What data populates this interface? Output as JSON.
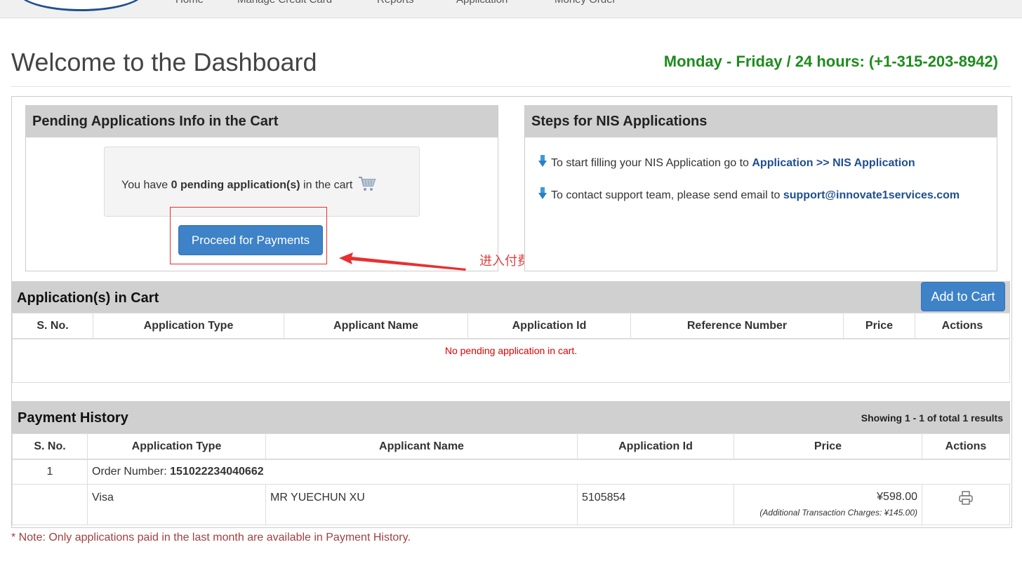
{
  "nav": {
    "items": [
      "Home",
      "Manage Credit Card",
      "Reports",
      "Application",
      "Money Order"
    ]
  },
  "header": {
    "title": "Welcome to the Dashboard",
    "hours": "Monday - Friday / 24 hours: (+1-315-203-8942)"
  },
  "pending_panel": {
    "title": "Pending Applications Info in the Cart",
    "text_prefix": "You have ",
    "count_text": "0 pending application(s)",
    "text_suffix": " in the cart",
    "proceed_label": "Proceed for Payments",
    "annotation": "进入付费"
  },
  "steps_panel": {
    "title": "Steps for NIS Applications",
    "step1_prefix": "To start filling your NIS Application go to ",
    "step1_link": "Application >> NIS Application",
    "step2_prefix": "To contact support team, please send email to ",
    "step2_link": "support@innovate1services.com"
  },
  "cart": {
    "title": "Application(s) in Cart",
    "add_label": "Add to Cart",
    "columns": [
      "S. No.",
      "Application Type",
      "Applicant Name",
      "Application Id",
      "Reference Number",
      "Price",
      "Actions"
    ],
    "empty_message": "No pending application in cart."
  },
  "history": {
    "title": "Payment History",
    "showing": "Showing 1 - 1 of total 1 results",
    "columns": [
      "S. No.",
      "Application Type",
      "Applicant Name",
      "Application Id",
      "Price",
      "Actions"
    ],
    "order_sno": "1",
    "order_label": "Order Number: ",
    "order_number": "151022234040662",
    "row": {
      "type": "Visa",
      "name": "MR YUECHUN XU",
      "app_id": "5105854",
      "price": "¥598.00",
      "charges": "(Additional Transaction Charges: ¥145.00)"
    }
  },
  "note": "* Note: Only applications paid in the last month are available in Payment History."
}
